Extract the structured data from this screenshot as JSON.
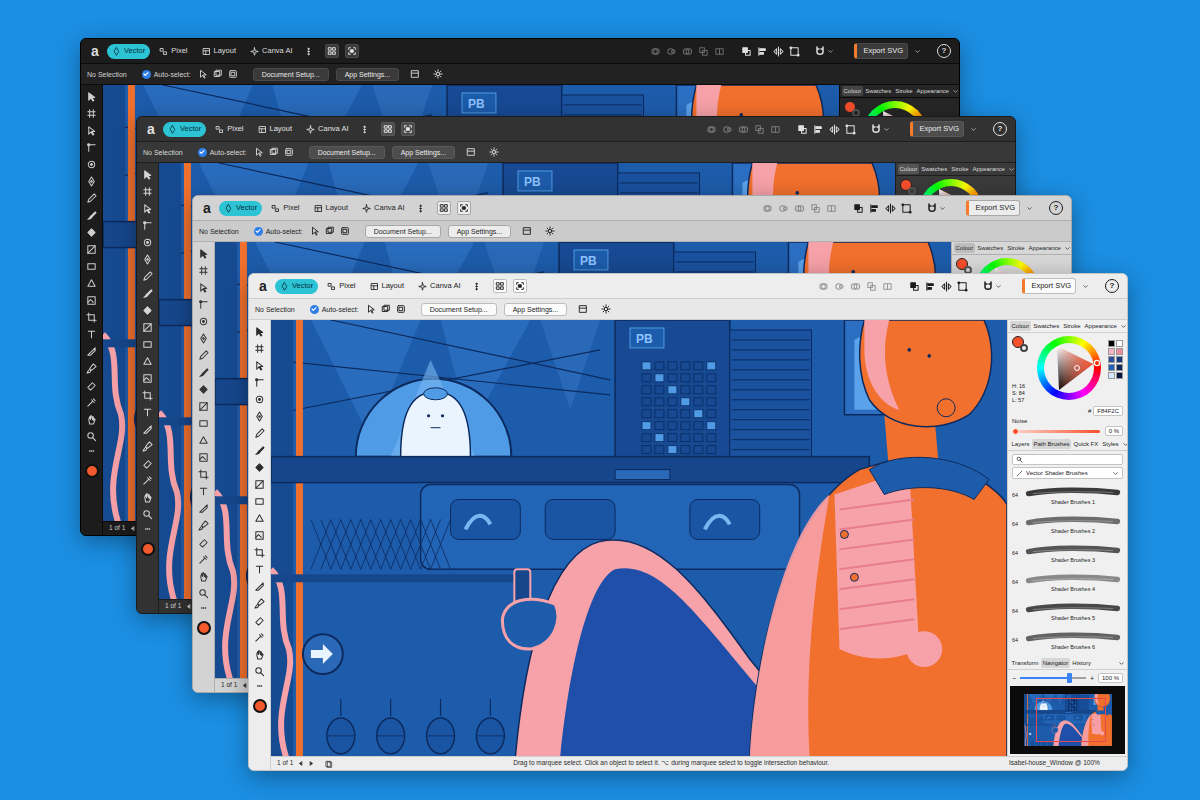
{
  "windows": [
    {
      "kind": "black",
      "toolbar": {
        "logo": "a",
        "personas": [
          {
            "label": "Vector",
            "selected": true
          },
          {
            "label": "Pixel",
            "selected": false
          },
          {
            "label": "Layout",
            "selected": false
          },
          {
            "label": "Canva AI",
            "selected": false
          }
        ],
        "export": "Export SVG",
        "help": "?"
      },
      "context_bar": {
        "selection": "No Selection",
        "auto_select": {
          "label": "Auto-select:",
          "checked": true
        },
        "buttons": [
          "Document Setup...",
          "App Settings..."
        ]
      },
      "panel_tabs": [
        {
          "label": "Colour",
          "selected": true
        },
        {
          "label": "Swatches",
          "selected": false
        },
        {
          "label": "Stroke",
          "selected": false
        },
        {
          "label": "Appearance",
          "selected": false
        }
      ],
      "canvas": {
        "sign": "PB"
      },
      "status_bar": {
        "page": "1 of 1"
      }
    },
    {
      "kind": "dark",
      "toolbar": {
        "logo": "a",
        "personas": [
          {
            "label": "Vector",
            "selected": true
          },
          {
            "label": "Pixel",
            "selected": false
          },
          {
            "label": "Layout",
            "selected": false
          },
          {
            "label": "Canva AI",
            "selected": false
          }
        ],
        "export": "Export SVG",
        "help": "?"
      },
      "context_bar": {
        "selection": "No Selection",
        "auto_select": {
          "label": "Auto-select:",
          "checked": true
        },
        "buttons": [
          "Document Setup...",
          "App Settings..."
        ]
      },
      "panel_tabs": [
        {
          "label": "Colour",
          "selected": true
        },
        {
          "label": "Swatches",
          "selected": false
        },
        {
          "label": "Stroke",
          "selected": false
        },
        {
          "label": "Appearance",
          "selected": false
        }
      ],
      "canvas": {
        "sign": "PB"
      },
      "status_bar": {
        "page": "1 of 1"
      }
    },
    {
      "kind": "light",
      "toolbar": {
        "logo": "a",
        "personas": [
          {
            "label": "Vector",
            "selected": true
          },
          {
            "label": "Pixel",
            "selected": false
          },
          {
            "label": "Layout",
            "selected": false
          },
          {
            "label": "Canva AI",
            "selected": false
          }
        ],
        "export": "Export SVG",
        "help": "?"
      },
      "context_bar": {
        "selection": "No Selection",
        "auto_select": {
          "label": "Auto-select:",
          "checked": true
        },
        "buttons": [
          "Document Setup...",
          "App Settings..."
        ]
      },
      "panel_tabs": [
        {
          "label": "Colour",
          "selected": true
        },
        {
          "label": "Swatches",
          "selected": false
        },
        {
          "label": "Stroke",
          "selected": false
        },
        {
          "label": "Appearance",
          "selected": false
        }
      ],
      "canvas": {
        "sign": "PB"
      },
      "status_bar": {
        "page": "1 of 1"
      }
    },
    {
      "kind": "white",
      "toolbar": {
        "logo": "a",
        "personas": [
          {
            "label": "Vector",
            "selected": true
          },
          {
            "label": "Pixel",
            "selected": false
          },
          {
            "label": "Layout",
            "selected": false
          },
          {
            "label": "Canva AI",
            "selected": false
          }
        ],
        "export": "Export SVG",
        "help": "?"
      },
      "context_bar": {
        "selection": "No Selection",
        "auto_select": {
          "label": "Auto-select:",
          "checked": true
        },
        "buttons": [
          "Document Setup...",
          "App Settings..."
        ]
      },
      "panel_tabs": [
        {
          "label": "Colour",
          "selected": true
        },
        {
          "label": "Swatches",
          "selected": false
        },
        {
          "label": "Stroke",
          "selected": false
        },
        {
          "label": "Appearance",
          "selected": false
        }
      ],
      "canvas": {
        "sign": "PB"
      },
      "panel": {
        "colour": {
          "h": "H: 16",
          "s": "S: 84",
          "l": "L: 57",
          "hex_label": "#",
          "hex": "F84F2C",
          "swatches": [
            {
              "color": "#000000"
            },
            {
              "color": "#ffffff"
            },
            {
              "color": "#f4b8c2"
            },
            {
              "color": "#f08a9c"
            },
            {
              "color": "#2a4e9a"
            },
            {
              "color": "#173a7a"
            },
            {
              "color": "#1f5fb8"
            },
            {
              "color": "#0f2a5a"
            },
            {
              "color": "#d4e8ff"
            },
            {
              "color": "#08163a"
            }
          ],
          "noise": {
            "label": "Noise",
            "level": 0,
            "reading": "0 %"
          }
        },
        "studio_tabs": [
          {
            "label": "Layers",
            "selected": false
          },
          {
            "label": "Path Brushes",
            "selected": true
          },
          {
            "label": "Quick FX",
            "selected": false
          },
          {
            "label": "Styles",
            "selected": false
          }
        ],
        "brushes": {
          "category": "Vector Shader Brushes",
          "items": [
            {
              "size": "64",
              "name": "Shader Brushes 1"
            },
            {
              "size": "64",
              "name": "Shader Brushes 2"
            },
            {
              "size": "64",
              "name": "Shader Brushes 3"
            },
            {
              "size": "64",
              "name": "Shader Brushes 4"
            },
            {
              "size": "64",
              "name": "Shader Brushes 5"
            },
            {
              "size": "64",
              "name": "Shader Brushes 6"
            }
          ]
        },
        "navigator_tabs": [
          {
            "label": "Transform",
            "selected": false
          },
          {
            "label": "Navigator",
            "selected": true
          },
          {
            "label": "History",
            "selected": false
          }
        ],
        "zoom": {
          "minus": "−",
          "plus": "+",
          "level": 0.74,
          "reading": "100 %"
        }
      },
      "status_bar": {
        "page": "1 of 1",
        "hint": "Drag to marquee select. Click an object to select it. ⌥ during marquee select to toggle intersection behaviour.",
        "document": "Isabel-house_Window @ 100%"
      }
    }
  ]
}
